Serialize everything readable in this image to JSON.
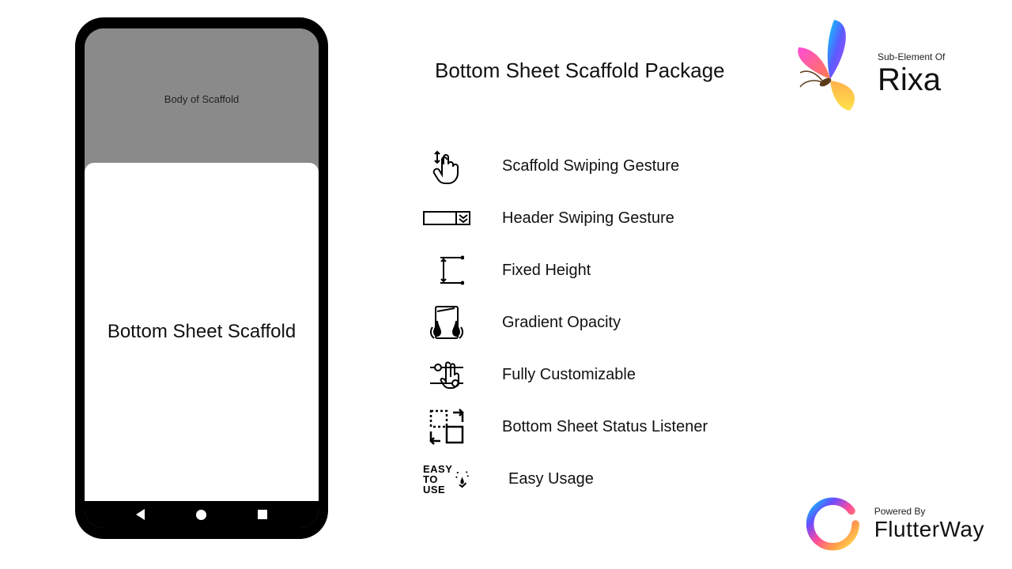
{
  "title": "Bottom Sheet Scaffold Package",
  "phone": {
    "body_label": "Body of Scaffold",
    "sheet_label": "Bottom Sheet Scaffold"
  },
  "features": [
    {
      "label": "Scaffold Swiping Gesture",
      "icon": "swipe-hand-icon"
    },
    {
      "label": "Header Swiping Gesture",
      "icon": "header-swipe-icon"
    },
    {
      "label": "Fixed Height",
      "icon": "fixed-height-icon"
    },
    {
      "label": "Gradient Opacity",
      "icon": "gradient-opacity-icon"
    },
    {
      "label": "Fully Customizable",
      "icon": "customizable-icon"
    },
    {
      "label": "Bottom Sheet Status Listener",
      "icon": "status-listener-icon"
    },
    {
      "label": "Easy Usage",
      "icon": "easy-use-icon"
    }
  ],
  "rixa": {
    "sub": "Sub-Element Of",
    "name": "Rixa"
  },
  "flutterway": {
    "sub": "Powered By",
    "name": "FlutterWay"
  },
  "easy_badge": {
    "l1": "EASY",
    "l2": "TO",
    "l3": "USE"
  }
}
